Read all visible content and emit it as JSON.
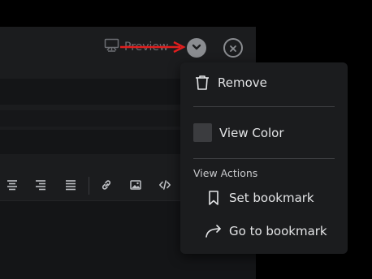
{
  "header": {
    "preview_label": "Preview"
  },
  "menu": {
    "remove_label": "Remove",
    "view_color_label": "View Color",
    "section_title": "View Actions",
    "set_bookmark_label": "Set bookmark",
    "go_to_bookmark_label": "Go to bookmark"
  },
  "colors": {
    "annotation_arrow": "#e01e1e",
    "menu_background": "#1b1c1e",
    "swatch": "#3b3c3f"
  },
  "toolbar": {
    "icons": [
      "align-center-icon",
      "align-right-icon",
      "align-justify-icon",
      "link-icon",
      "image-icon",
      "code-icon"
    ]
  }
}
